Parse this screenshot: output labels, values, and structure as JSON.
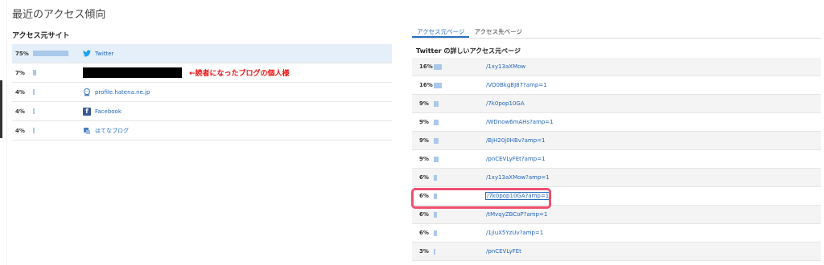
{
  "page": {
    "title": "最近のアクセス傾向"
  },
  "left": {
    "title": "アクセス元サイト",
    "rows": [
      {
        "pct": "75%",
        "value": 75,
        "site": "Twitter",
        "icon": "twitter-icon"
      },
      {
        "pct": "7%",
        "value": 7,
        "site": "",
        "icon": ""
      },
      {
        "pct": "4%",
        "value": 4,
        "site": "profile.hatena.ne.jp",
        "icon": "hatena-profile-icon"
      },
      {
        "pct": "4%",
        "value": 4,
        "site": "Facebook",
        "icon": "facebook-icon"
      },
      {
        "pct": "4%",
        "value": 4,
        "site": "はてなブログ",
        "icon": "hatena-blog-icon"
      }
    ],
    "annotation": "←読者になったブログの個人様"
  },
  "right": {
    "tabs": [
      "アクセス元ページ",
      "アクセス先ページ"
    ],
    "title": "Twitter の詳しいアクセス元ページ",
    "rows": [
      {
        "pct": "16%",
        "value": 16,
        "url": "/1xy13aXMow"
      },
      {
        "pct": "16%",
        "value": 16,
        "url": "/VO0BkgBJ87?amp=1"
      },
      {
        "pct": "9%",
        "value": 9,
        "url": "/7k0pop10GA"
      },
      {
        "pct": "9%",
        "value": 9,
        "url": "/WDnow6mAHs?amp=1"
      },
      {
        "pct": "9%",
        "value": 9,
        "url": "/BjH20j0HBv?amp=1"
      },
      {
        "pct": "9%",
        "value": 9,
        "url": "/pnCEVLyFEt?amp=1"
      },
      {
        "pct": "6%",
        "value": 6,
        "url": "/1xy13aXMow?amp=1"
      },
      {
        "pct": "6%",
        "value": 6,
        "url": "/7k0pop10GA?amp=1"
      },
      {
        "pct": "6%",
        "value": 6,
        "url": "/tMvqyZBCoP?amp=1"
      },
      {
        "pct": "6%",
        "value": 6,
        "url": "/1jiuX5YzUv?amp=1"
      },
      {
        "pct": "3%",
        "value": 3,
        "url": "/pnCEVLyFEt"
      }
    ]
  },
  "colors": {
    "bar": "#a9c8ea",
    "link": "#2266bb",
    "highlight": "#f0506e",
    "annotation": "#e11111"
  }
}
